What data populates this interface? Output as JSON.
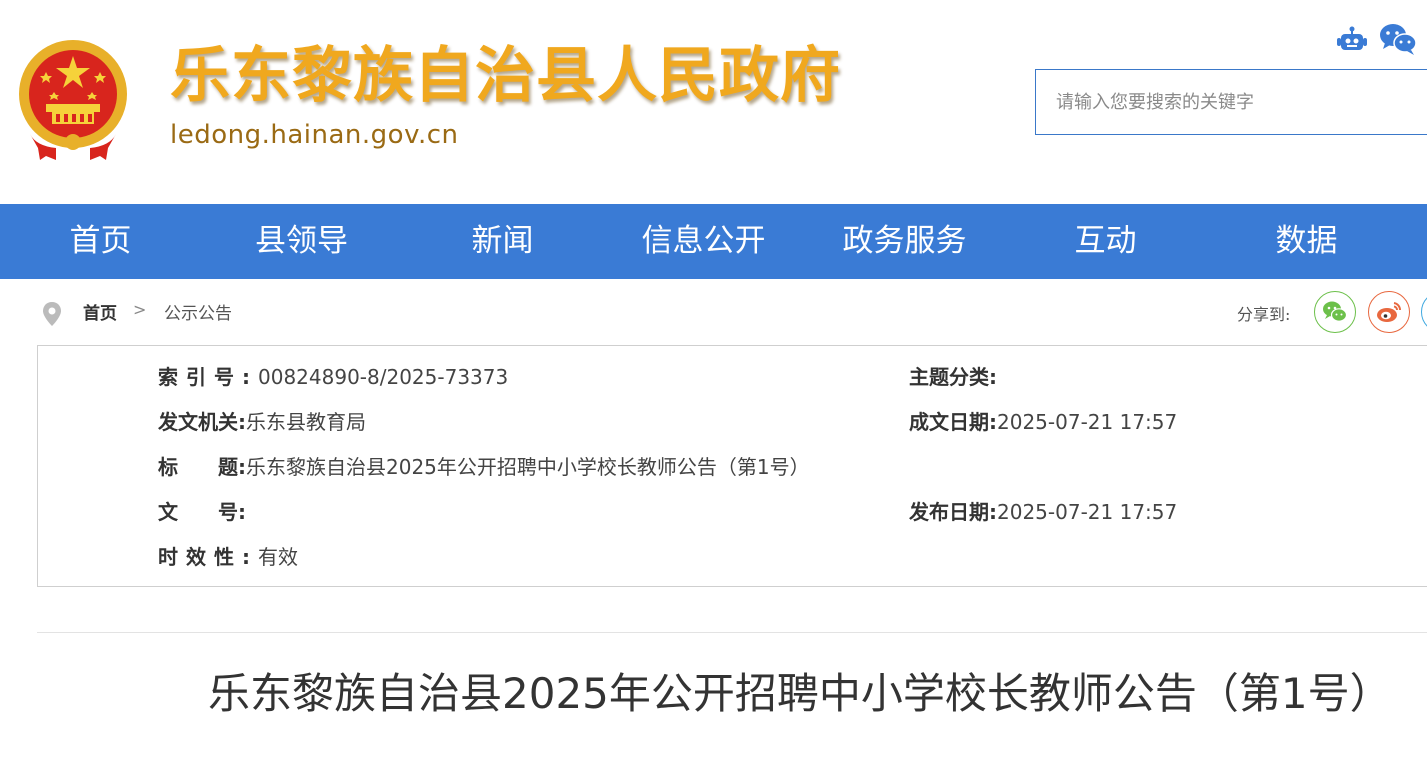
{
  "header": {
    "site_title": "乐东黎族自治县人民政府",
    "site_domain": "ledong.hainan.gov.cn",
    "search_placeholder": "请输入您要搜索的关键字",
    "icons": [
      "national-emblem",
      "robot-icon",
      "wechat-icon"
    ]
  },
  "nav": {
    "items": [
      "首页",
      "县领导",
      "新闻",
      "信息公开",
      "政务服务",
      "互动",
      "数据"
    ]
  },
  "breadcrumb": {
    "home": "首页",
    "separator": ">",
    "current": "公示公告"
  },
  "share": {
    "label": "分享到:",
    "icons": [
      "wechat-icon",
      "weibo-icon",
      "share-icon"
    ]
  },
  "info": {
    "index_label": "索引号:",
    "index_value": "00824890-8/2025-73373",
    "topic_label": "主题分类:",
    "topic_value": "",
    "issuer_label": "发文机关:",
    "issuer_value": "乐东县教育局",
    "written_date_label": "成文日期:",
    "written_date_value": "2025-07-21 17:57",
    "title_label": "标　　题:",
    "title_value": "乐东黎族自治县2025年公开招聘中小学校长教师公告（第1号）",
    "doc_no_label": "文　　号:",
    "doc_no_value": "",
    "publish_date_label": "发布日期:",
    "publish_date_value": "2025-07-21 17:57",
    "validity_label": "时效性:",
    "validity_value": "有效"
  },
  "article": {
    "title": "乐东黎族自治县2025年公开招聘中小学校长教师公告（第1号）"
  },
  "colors": {
    "nav_bg": "#3a7bd5",
    "title_gold": "#f0a81e",
    "domain_brown": "#9a6a14"
  }
}
